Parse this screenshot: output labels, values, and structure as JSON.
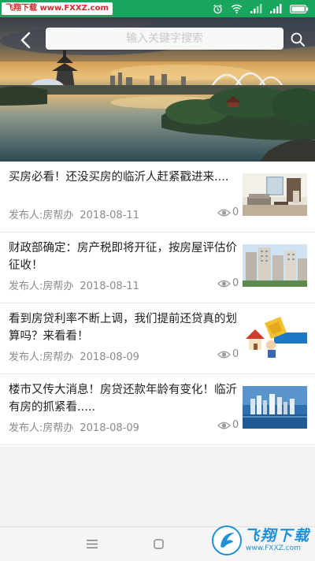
{
  "status_bar": {
    "watermark": "飞翔下载 www.FXXZ.com",
    "background": "#17a65b"
  },
  "header": {
    "back_icon": "chevron-left-icon",
    "search": {
      "placeholder": "输入关键字搜索",
      "value": ""
    },
    "search_icon": "search-icon"
  },
  "news": [
    {
      "title": "买房必看！还没买房的临沂人赶紧戳进来....",
      "publisher": "发布人:房帮办",
      "date": "2018-08-11",
      "views": "0",
      "thumb": "living-room"
    },
    {
      "title": "财政部确定：房产税即将开征，按房屋评估价征收！",
      "publisher": "发布人:房帮办",
      "date": "2018-08-11",
      "views": "0",
      "thumb": "apartment-buildings"
    },
    {
      "title": "看到房贷利率不断上调，我们提前还贷真的划算吗？来看看！",
      "publisher": "发布人:房帮办",
      "date": "2018-08-09",
      "views": "0",
      "thumb": "loan-cartoon"
    },
    {
      "title": "楼市又传大消息！房贷还款年龄有变化！临沂有房的抓紧看.....",
      "publisher": "发布人:房帮办",
      "date": "2018-08-09",
      "views": "0",
      "thumb": "city-skyline"
    }
  ],
  "nav_bar": {
    "menu_icon": "menu-icon",
    "home_icon": "home-square-icon"
  },
  "watermark_logo": {
    "text": "飞翔下载",
    "url": "www.FXXZ.com"
  },
  "colors": {
    "accent": "#17a65b",
    "meta_text": "#8a8a8a",
    "watermark_blue": "#1f8fd6"
  }
}
